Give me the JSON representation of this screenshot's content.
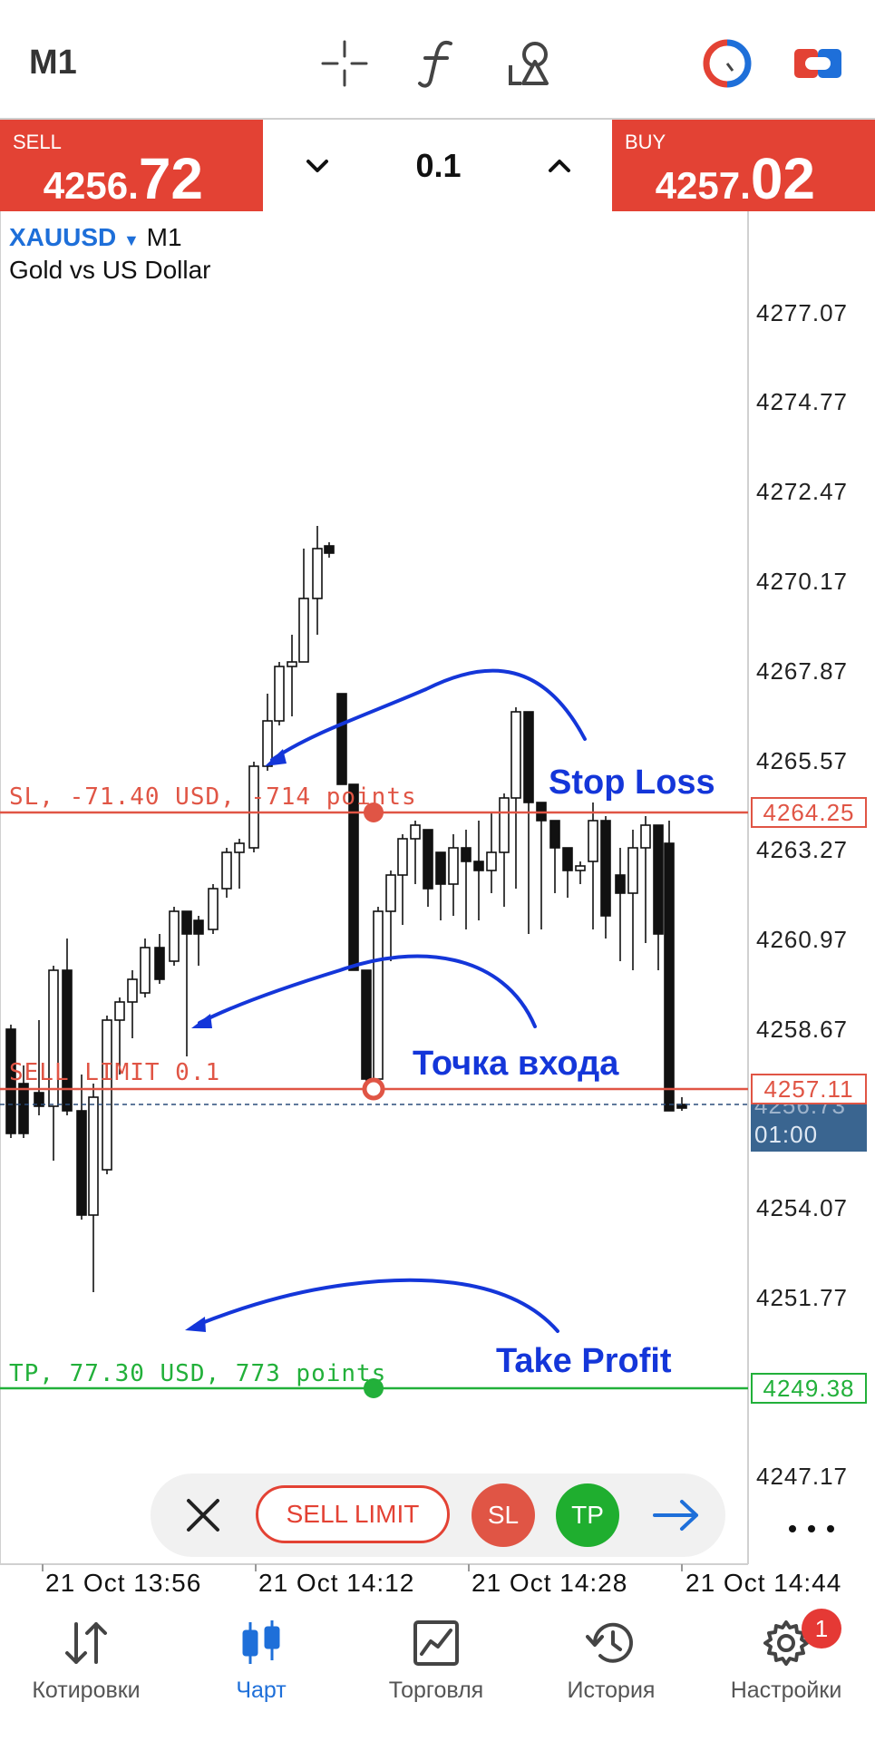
{
  "header": {
    "timeframe": "M1",
    "icons": [
      "crosshair-icon",
      "function-icon",
      "objects-icon",
      "one-click-trading-icon",
      "account-toggle-icon"
    ]
  },
  "quote": {
    "sell": {
      "label": "SELL",
      "price_small": "4256.",
      "price_big": "72"
    },
    "buy": {
      "label": "BUY",
      "price_small": "4257.",
      "price_big": "02"
    },
    "volume": "0.1"
  },
  "chart": {
    "symbol": "XAUUSD",
    "timeframe": "M1",
    "description": "Gold vs US Dollar",
    "price_ticks": [
      "4277.07",
      "4274.77",
      "4272.47",
      "4270.17",
      "4267.87",
      "4265.57",
      "4263.27",
      "4260.97",
      "4258.67",
      "4254.07",
      "4251.77",
      "4247.17"
    ],
    "levels": {
      "sl": {
        "label": "SL, -71.40 USD, -714 points",
        "price": "4264.25",
        "color": "#e05545"
      },
      "entry": {
        "label": "SELL LIMIT 0.1",
        "price": "4257.11",
        "color": "#e05545"
      },
      "tp": {
        "label": "TP, 77.30 USD, 773 points",
        "price": "4249.38",
        "color": "#22b03a"
      }
    },
    "current": {
      "price": "4256.73",
      "countdown": "01:00",
      "color": "#3a6590"
    },
    "annotations": {
      "sl": "Stop Loss",
      "entry": "Точка входа",
      "tp": "Take Profit"
    },
    "time_labels": [
      "21 Oct 13:56",
      "21 Oct 14:12",
      "21 Oct 14:28",
      "21 Oct 14:44"
    ],
    "colors": {
      "accent": "#1e6fd9",
      "sell": "#e34234",
      "tp": "#22b03a",
      "annotation": "#1436d9"
    }
  },
  "order_toolbar": {
    "order_type": "SELL LIMIT",
    "sl": "SL",
    "tp": "TP"
  },
  "nav": {
    "items": [
      {
        "label": "Котировки",
        "icon": "quotes-icon"
      },
      {
        "label": "Чарт",
        "icon": "chart-icon",
        "active": true
      },
      {
        "label": "Торговля",
        "icon": "trade-icon"
      },
      {
        "label": "История",
        "icon": "history-icon"
      },
      {
        "label": "Настройки",
        "icon": "settings-icon"
      }
    ],
    "settings_badge": "1"
  }
}
